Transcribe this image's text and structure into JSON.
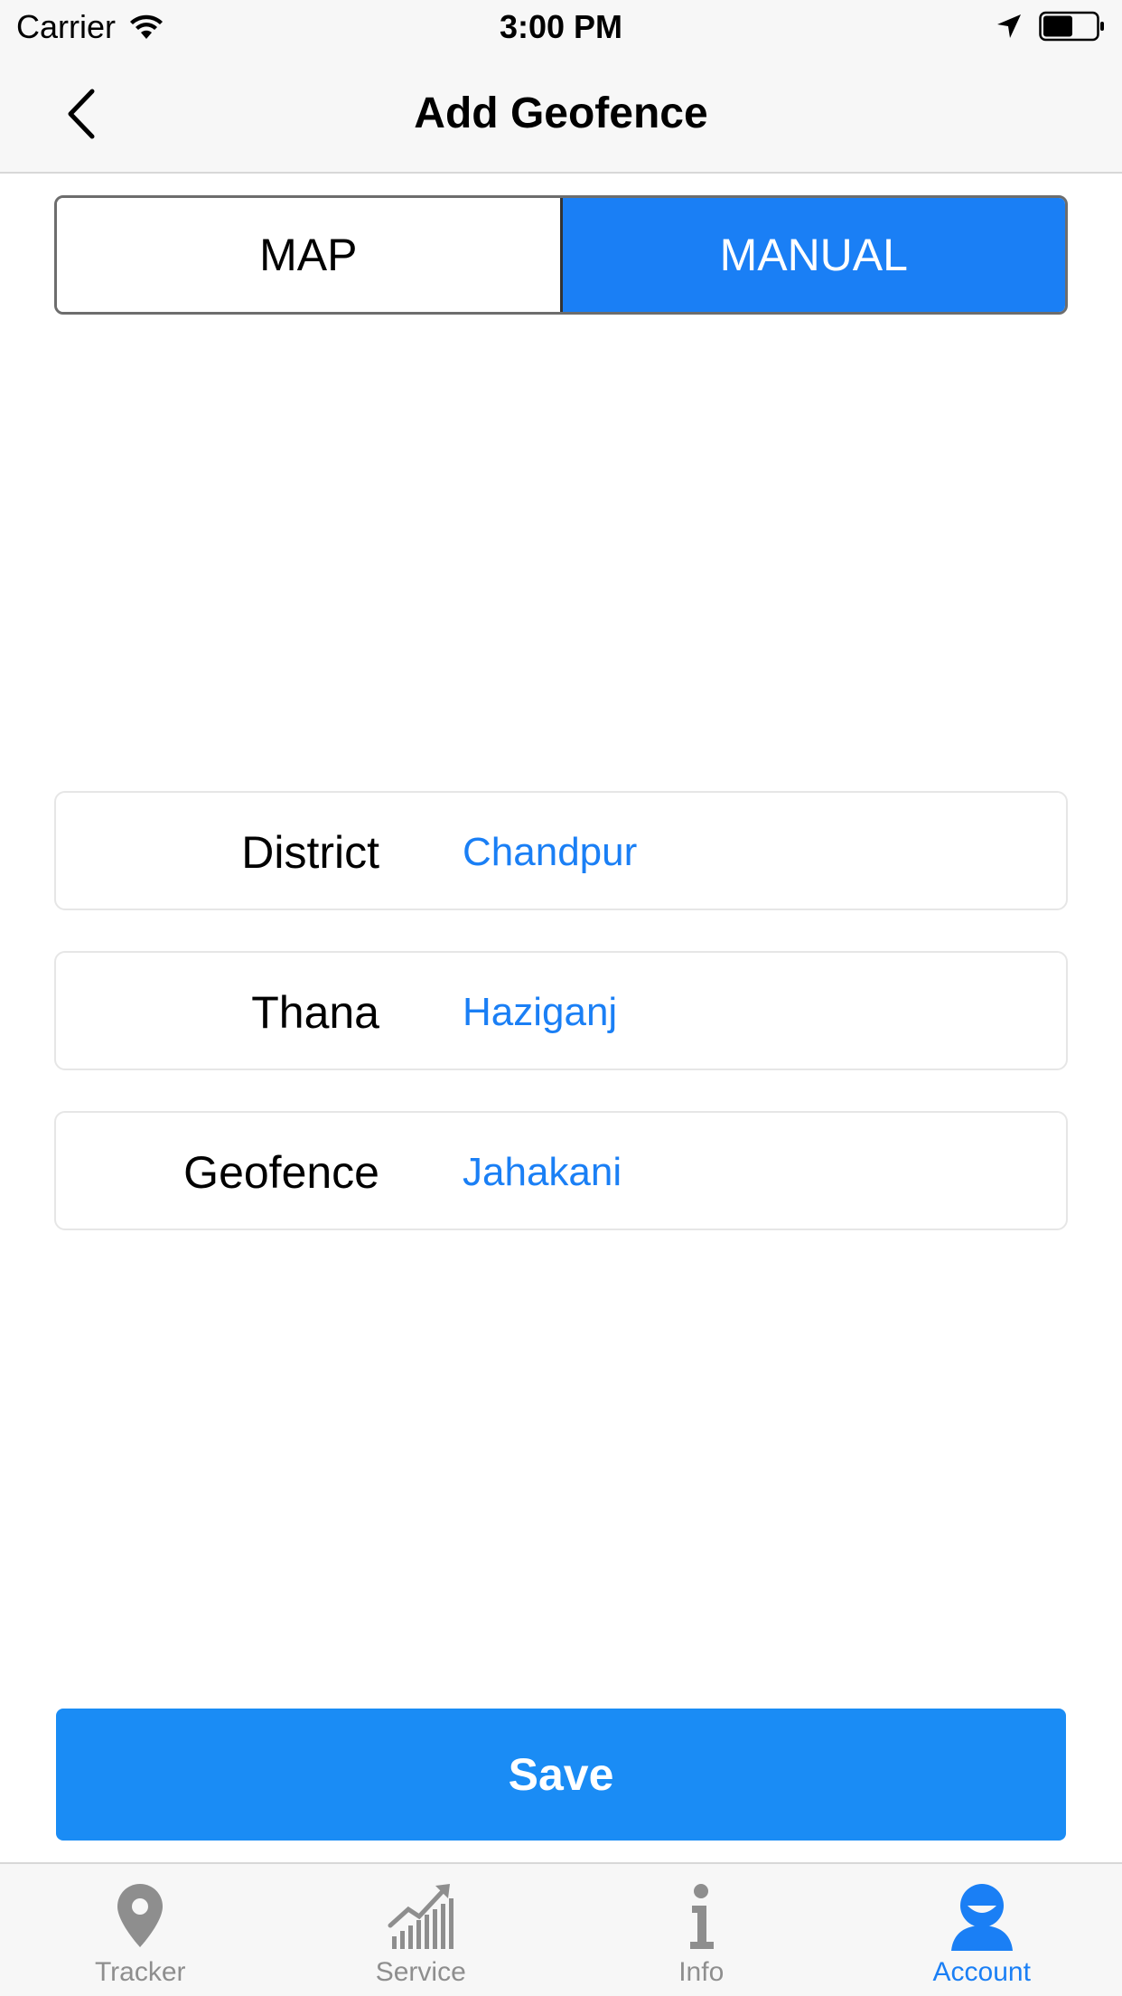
{
  "status_bar": {
    "carrier": "Carrier",
    "time": "3:00 PM"
  },
  "nav": {
    "title": "Add Geofence"
  },
  "segmented": {
    "options": [
      "MAP",
      "MANUAL"
    ],
    "selected": "MANUAL"
  },
  "fields": [
    {
      "label": "District",
      "value": "Chandpur"
    },
    {
      "label": "Thana",
      "value": "Haziganj"
    },
    {
      "label": "Geofence",
      "value": "Jahakani"
    }
  ],
  "save_label": "Save",
  "tab_bar": {
    "tabs": [
      {
        "label": "Tracker",
        "icon": "location-pin-icon"
      },
      {
        "label": "Service",
        "icon": "growth-chart-icon"
      },
      {
        "label": "Info",
        "icon": "info-icon"
      },
      {
        "label": "Account",
        "icon": "account-icon"
      }
    ],
    "active": "Account"
  },
  "colors": {
    "accent": "#1a7ff5",
    "save_button": "#1a8cf5",
    "inactive_tab": "#8e8e8e"
  }
}
